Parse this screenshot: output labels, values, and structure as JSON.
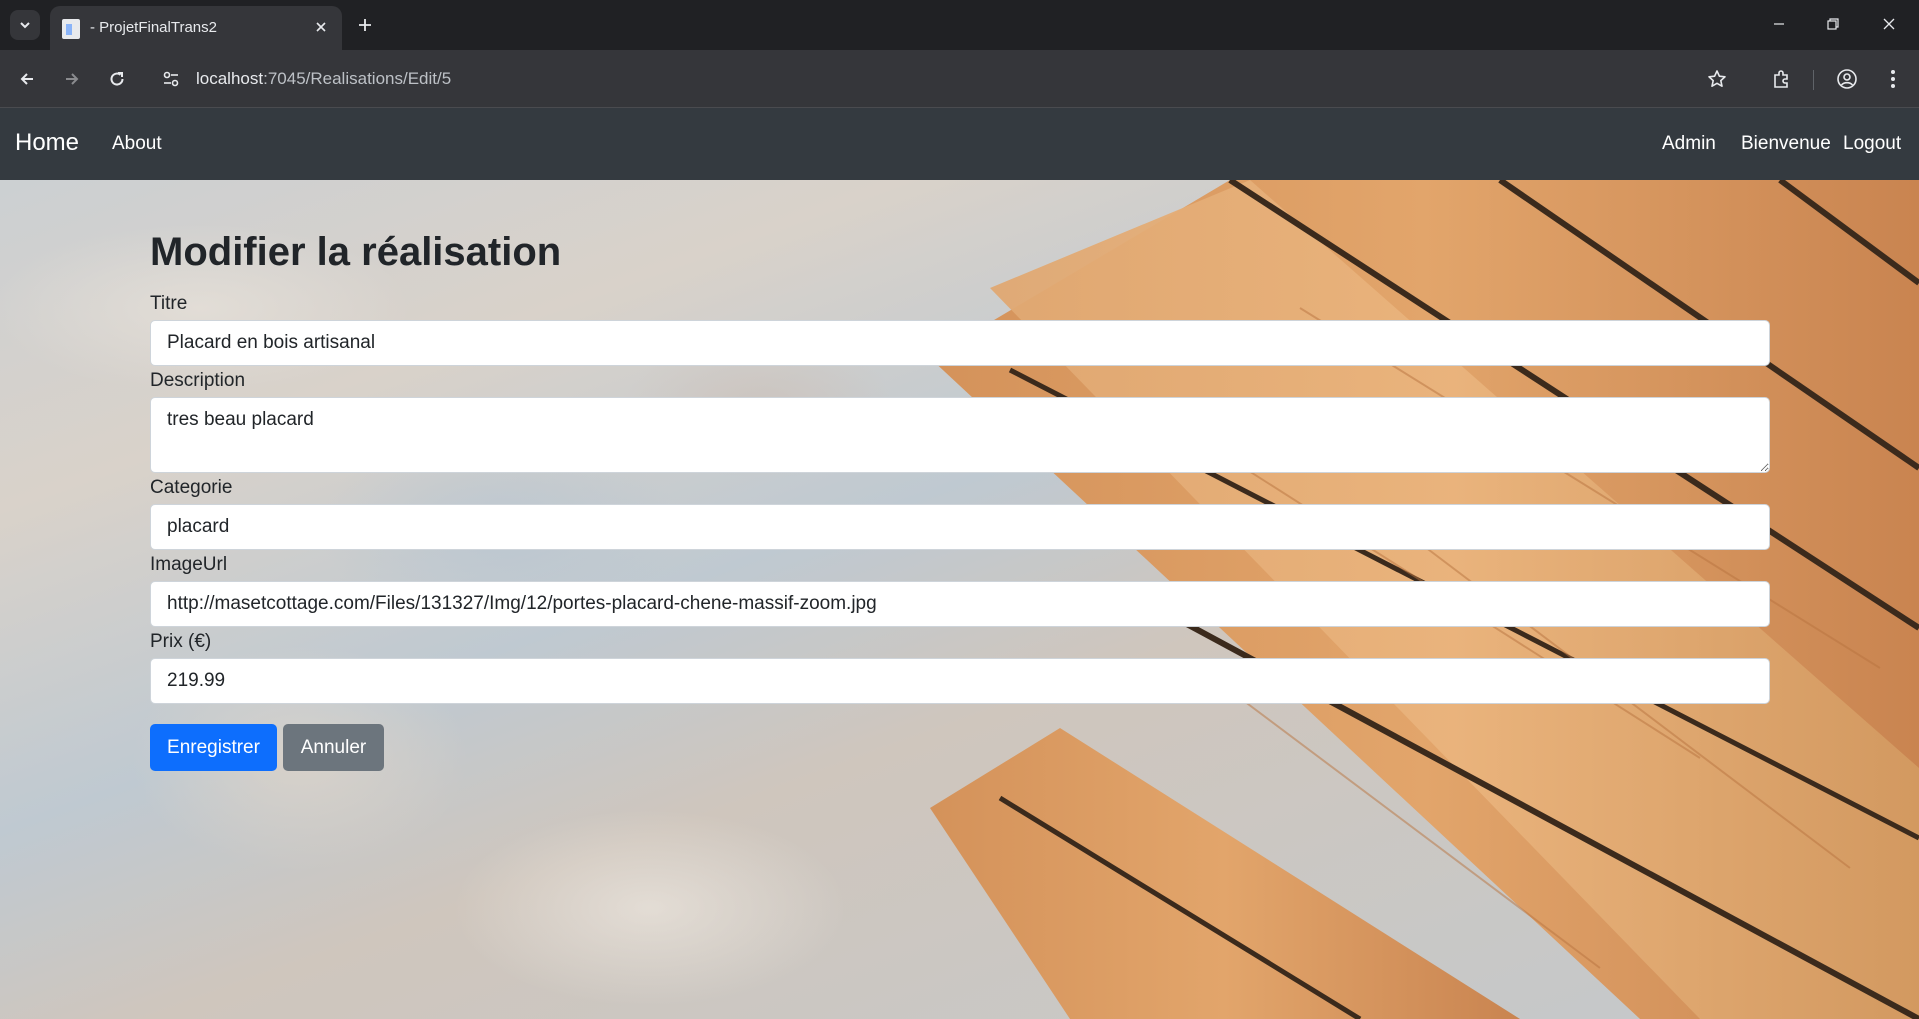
{
  "browser": {
    "tab_title": "- ProjetFinalTrans2",
    "url_host": "localhost",
    "url_rest": ":7045/Realisations/Edit/5"
  },
  "navbar": {
    "brand": "Home",
    "about": "About",
    "admin": "Admin",
    "welcome": "Bienvenue",
    "logout": "Logout"
  },
  "form": {
    "heading": "Modifier la réalisation",
    "titre_label": "Titre",
    "titre_value": "Placard en bois artisanal",
    "description_label": "Description",
    "description_value": "tres beau placard",
    "categorie_label": "Categorie",
    "categorie_value": "placard",
    "imageurl_label": "ImageUrl",
    "imageurl_value": "http://masetcottage.com/Files/131327/Img/12/portes-placard-chene-massif-zoom.jpg",
    "prix_label": "Prix (€)",
    "prix_value": "219.99",
    "save_label": "Enregistrer",
    "cancel_label": "Annuler"
  },
  "colors": {
    "navbar": "#343a40",
    "primary": "#0d6efd",
    "secondary": "#6c757d"
  }
}
